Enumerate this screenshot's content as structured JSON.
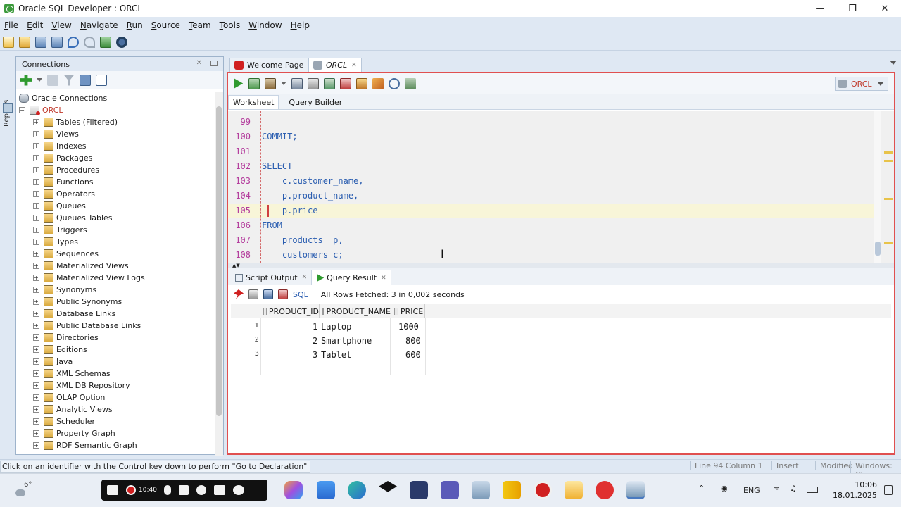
{
  "window": {
    "title": "Oracle SQL Developer : ORCL"
  },
  "menu": [
    "File",
    "Edit",
    "View",
    "Navigate",
    "Run",
    "Source",
    "Team",
    "Tools",
    "Window",
    "Help"
  ],
  "side_strip": {
    "label": "Reports"
  },
  "connections": {
    "panel_title": "Connections",
    "root": "Oracle Connections",
    "connection": "ORCL",
    "items": [
      "Tables (Filtered)",
      "Views",
      "Indexes",
      "Packages",
      "Procedures",
      "Functions",
      "Operators",
      "Queues",
      "Queues Tables",
      "Triggers",
      "Types",
      "Sequences",
      "Materialized Views",
      "Materialized View Logs",
      "Synonyms",
      "Public Synonyms",
      "Database Links",
      "Public Database Links",
      "Directories",
      "Editions",
      "Java",
      "XML Schemas",
      "XML DB Repository",
      "OLAP Option",
      "Analytic Views",
      "Scheduler",
      "Property Graph",
      "RDF Semantic Graph"
    ]
  },
  "editor": {
    "tabs": [
      {
        "label": "Welcome Page",
        "active": false
      },
      {
        "label": "ORCL",
        "active": true
      }
    ],
    "connection_selector": "ORCL",
    "subtabs": [
      "Worksheet",
      "Query Builder"
    ],
    "code_lines": [
      {
        "num": "99",
        "text": ""
      },
      {
        "num": "100",
        "text": "COMMIT;"
      },
      {
        "num": "101",
        "text": ""
      },
      {
        "num": "102",
        "text": "SELECT"
      },
      {
        "num": "103",
        "text": "    c.customer_name,"
      },
      {
        "num": "104",
        "text": "    p.product_name,"
      },
      {
        "num": "105",
        "text": "    p.price"
      },
      {
        "num": "106",
        "text": "FROM"
      },
      {
        "num": "107",
        "text": "    products  p,"
      },
      {
        "num": "108",
        "text": "    customers c;"
      }
    ]
  },
  "output": {
    "tabs": [
      "Script Output",
      "Query Result"
    ],
    "sql_link": "SQL",
    "status": "All Rows Fetched: 3 in 0,002 seconds",
    "columns": [
      "PRODUCT_ID",
      "PRODUCT_NAME",
      "PRICE"
    ],
    "rows": [
      {
        "rn": "1",
        "id": "1",
        "name": "Laptop",
        "price": "1000"
      },
      {
        "rn": "2",
        "id": "2",
        "name": "Smartphone",
        "price": "800"
      },
      {
        "rn": "3",
        "id": "3",
        "name": "Tablet",
        "price": "600"
      }
    ]
  },
  "statusbar": {
    "message": "Click on an identifier with the Control key down to perform \"Go to Declaration\"",
    "position": "Line 94 Column 1",
    "mode": "Insert",
    "modified": "Modified",
    "platform": "Windows: CI"
  },
  "taskbar": {
    "temperature": "6°",
    "recording_time": "10:40",
    "language": "ENG",
    "time": "10:06",
    "date": "18.01.2025"
  },
  "colors": {
    "accent_red": "#e05050",
    "keyword_blue": "#2a5db0",
    "line_number": "#b33a9c"
  }
}
